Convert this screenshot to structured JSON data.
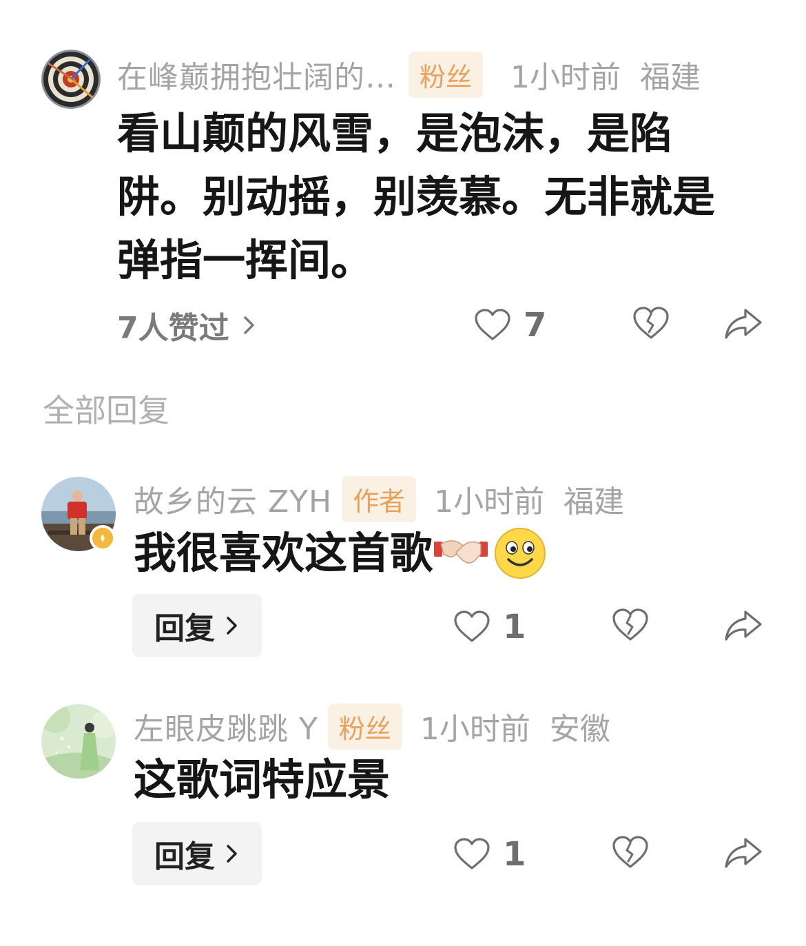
{
  "comment": {
    "username": "在峰巅拥抱壮阔的…",
    "tag": "粉丝",
    "time": "1小时前",
    "location": "福建",
    "content_lines": [
      "看山颠的风雪，是泡沫，是陷",
      "阱。别动摇，别羡慕。无非就是",
      "弹指一挥间。"
    ],
    "likes_summary": "7人赞过",
    "like_count": "7"
  },
  "section_title": "全部回复",
  "replies": [
    {
      "username": "故乡的云 ZYH",
      "tag": "作者",
      "time": "1小时前",
      "location": "福建",
      "content": "我很喜欢这首歌",
      "emojis": [
        "handshake-emoji",
        "smile-emoji"
      ],
      "reply_label": "回复",
      "like_count": "1"
    },
    {
      "username": "左眼皮跳跳 Y",
      "tag": "粉丝",
      "time": "1小时前",
      "location": "安徽",
      "content": "这歌词特应景",
      "reply_label": "回复",
      "like_count": "1"
    }
  ],
  "icons": {
    "heart": "heart-icon",
    "dislike": "broken-heart-icon",
    "share": "share-arrow-icon",
    "chevron": "chevron-right-icon"
  }
}
